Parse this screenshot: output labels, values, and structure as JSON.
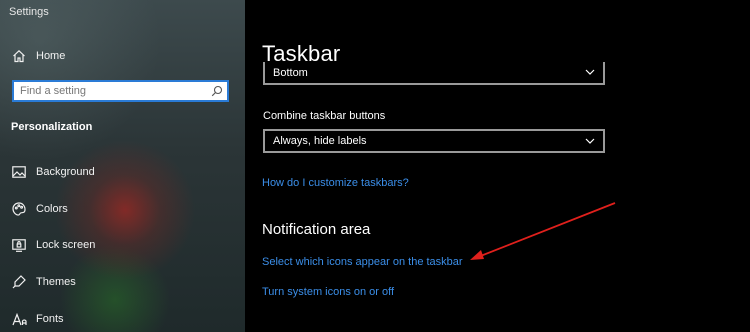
{
  "window": {
    "title": "Settings"
  },
  "sidebar": {
    "home_label": "Home",
    "search": {
      "placeholder": "Find a setting"
    },
    "section_title": "Personalization",
    "items": [
      {
        "label": "Background",
        "icon": "image-icon"
      },
      {
        "label": "Colors",
        "icon": "palette-icon"
      },
      {
        "label": "Lock screen",
        "icon": "lock-screen-icon"
      },
      {
        "label": "Themes",
        "icon": "themes-icon"
      },
      {
        "label": "Fonts",
        "icon": "fonts-icon"
      }
    ]
  },
  "main": {
    "title": "Taskbar",
    "position_dropdown": {
      "value": "Bottom"
    },
    "combine_label": "Combine taskbar buttons",
    "combine_dropdown": {
      "value": "Always, hide labels"
    },
    "customize_link": "How do I customize taskbars?",
    "notification_title": "Notification area",
    "select_icons_link": "Select which icons appear on the taskbar",
    "system_icons_link": "Turn system icons on or off"
  },
  "colors": {
    "accent_link": "#3b8ee8",
    "annotation_arrow": "#e0201c",
    "search_border": "#2a7bd6"
  }
}
